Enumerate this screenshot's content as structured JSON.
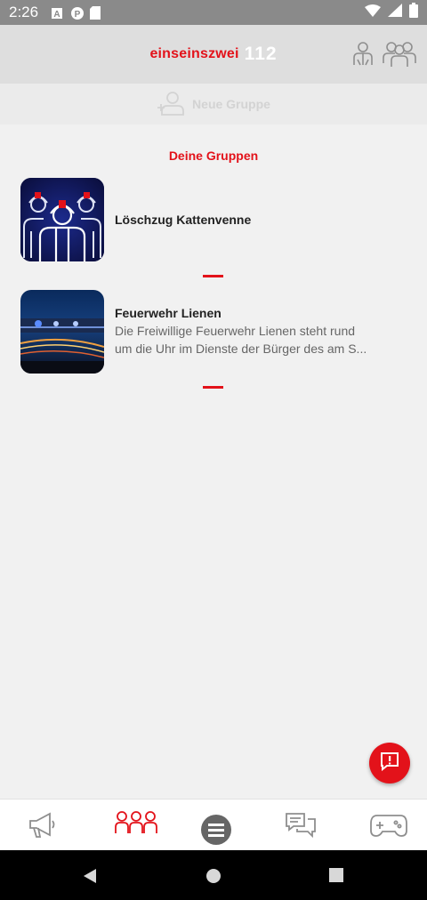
{
  "status_bar": {
    "time": "2:26",
    "icons": [
      "a-icon",
      "p-icon",
      "sim-icon",
      "wifi-icon",
      "signal-icon",
      "battery-icon"
    ]
  },
  "header": {
    "logo_text": "einseinszwei",
    "logo_number": "112",
    "icons": [
      "person-icon",
      "people-icon"
    ]
  },
  "new_group": {
    "label": "Neue Gruppe",
    "icon": "add-person-icon"
  },
  "groups_section": {
    "title": "Deine Gruppen",
    "items": [
      {
        "name": "Löschzug Kattenvenne",
        "description_line1": "",
        "description_line2": ""
      },
      {
        "name": "Feuerwehr Lienen",
        "description_line1": "Die Freiwillige Feuerwehr Lienen steht rund",
        "description_line2": "um die Uhr im Dienste der Bürger des am S..."
      }
    ]
  },
  "fab": {
    "icon": "report-icon"
  },
  "bottom_nav": {
    "items": [
      "megaphone-icon",
      "groups-icon",
      "menu-icon",
      "chat-icon",
      "gamepad-icon"
    ],
    "active": "groups-icon"
  },
  "colors": {
    "accent": "#e3121a",
    "header_bg": "#dedede",
    "page_bg": "#f1f1f1"
  }
}
